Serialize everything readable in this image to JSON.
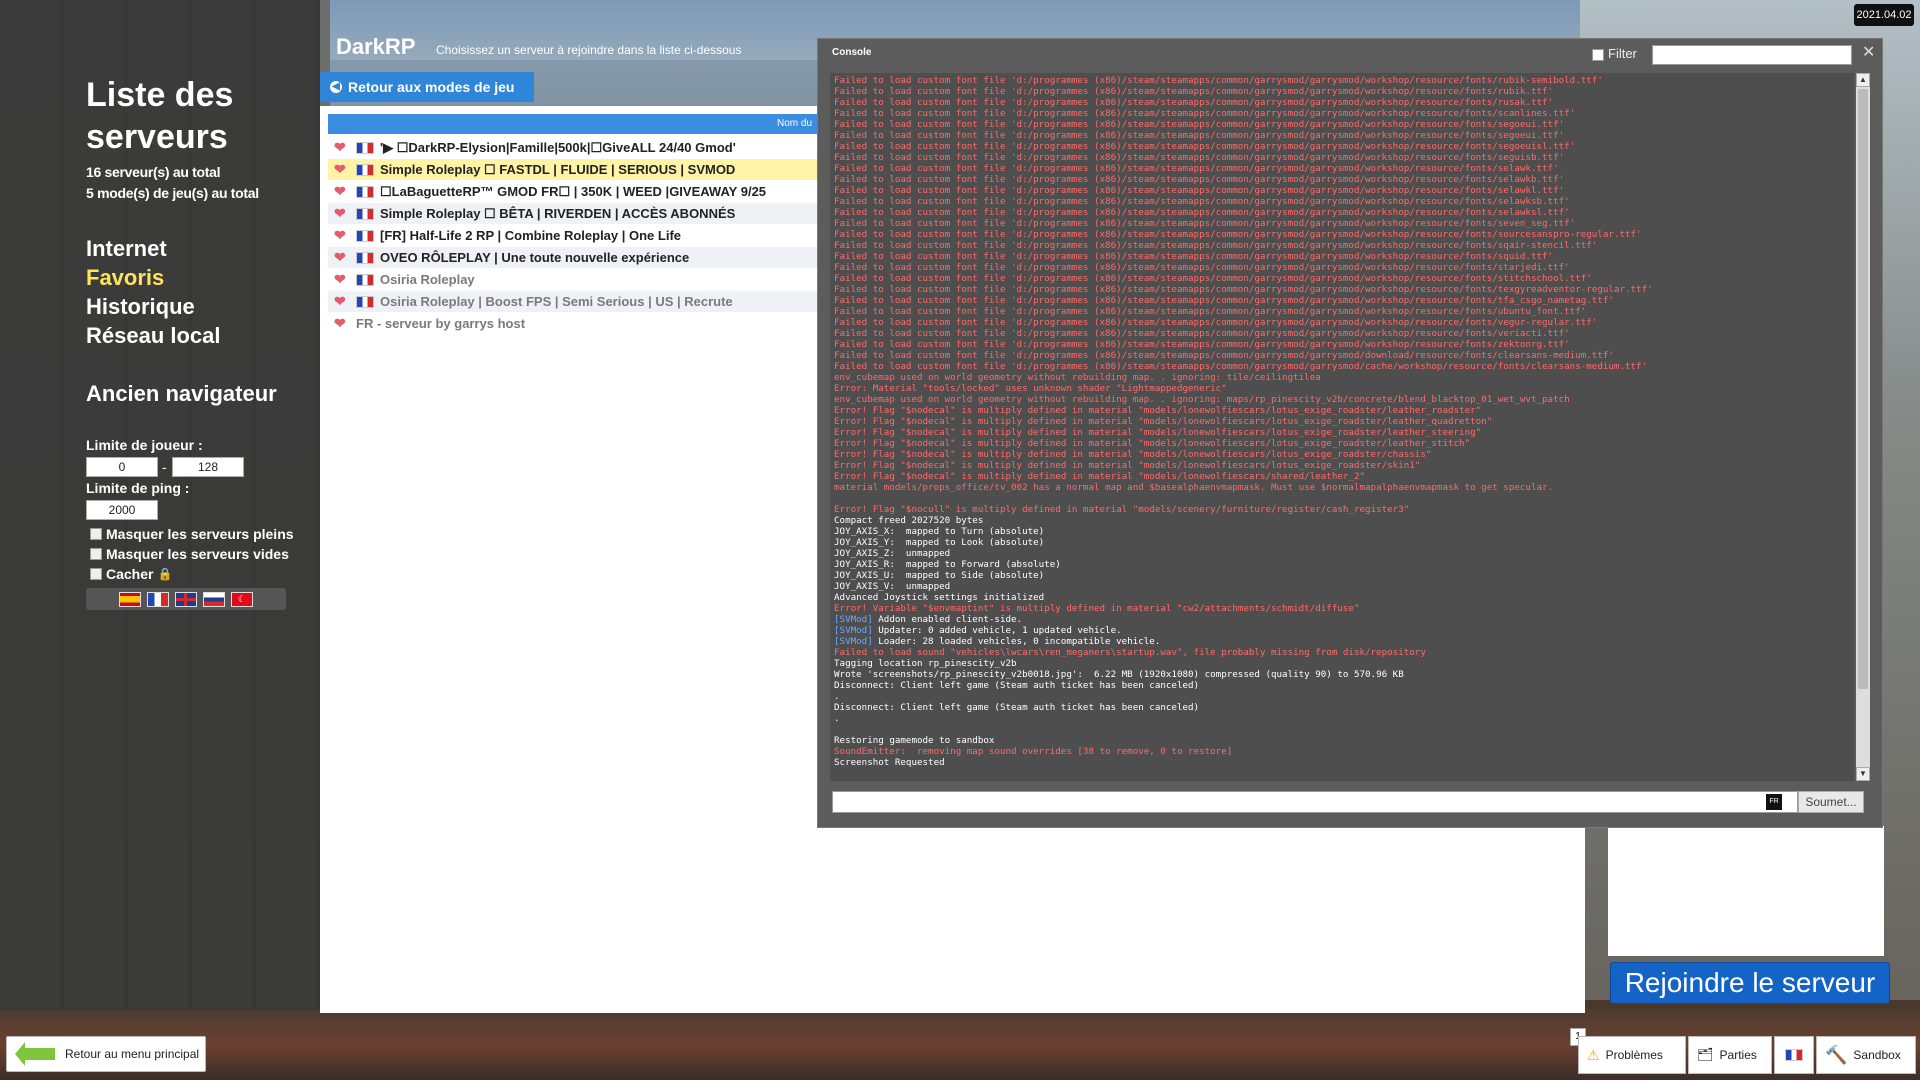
{
  "date": "2021.04.02",
  "gamemode": {
    "name": "DarkRP",
    "instruction": "Choisissez un serveur à rejoindre dans la liste ci-dessous"
  },
  "back_modes_label": "Retour aux modes de jeu",
  "sidebar": {
    "title": "Liste des serveurs",
    "total_servers": "16 serveur(s) au total",
    "total_modes": "5 mode(s) de jeu(s) au total",
    "nav": [
      "Internet",
      "Favoris",
      "Historique",
      "Réseau local"
    ],
    "legacy_browser": "Ancien navigateur",
    "player_limit_label": "Limite de joueur :",
    "player_min": "0",
    "player_max": "128",
    "ping_limit_label": "Limite de ping :",
    "ping_value": "2000",
    "hide_full": "Masquer les serveurs pleins",
    "hide_empty": "Masquer les serveurs vides",
    "hide_locked": "Cacher",
    "flags": [
      "flag-es",
      "flag-fr",
      "flag-gb",
      "flag-ru",
      "flag-tr"
    ]
  },
  "list": {
    "column_header": "Nom du",
    "servers": [
      "'▶ ☐DarkRP-Elysion|Famille|500k|☐GiveALL 24/40 Gmod'",
      "Simple Roleplay ☐ FASTDL | FLUIDE | SERIOUS | SVMOD",
      "☐LaBaguetteRP™ GMOD FR☐ | 350K | WEED |GIVEAWAY 9/25",
      "Simple Roleplay ☐ BÊTA | RIVERDEN | ACCÈS ABONNÉS",
      "[FR] Half-Life 2 RP | Combine Roleplay | One Life",
      "OVEO RÔLEPLAY | Une toute nouvelle expérience",
      "Osiria Roleplay",
      "Osiria Roleplay | Boost FPS | Semi Serious | US | Recrute",
      "FR - serveur by garrys host"
    ]
  },
  "console": {
    "title": "Console",
    "filter_label": "Filter",
    "submit_label": "Soumet...",
    "lang_badge": "FR",
    "lines": [
      {
        "t": "e",
        "s": "Failed to load custom font file 'd:/programmes (x86)/steam/steamapps/common/garrysmod/garrysmod/workshop/resource/fonts/rubik-semibold.ttf'"
      },
      {
        "t": "e",
        "s": "Failed to load custom font file 'd:/programmes (x86)/steam/steamapps/common/garrysmod/garrysmod/workshop/resource/fonts/rubik.ttf'"
      },
      {
        "t": "e",
        "s": "Failed to load custom font file 'd:/programmes (x86)/steam/steamapps/common/garrysmod/garrysmod/workshop/resource/fonts/rusak.ttf'"
      },
      {
        "t": "e",
        "s": "Failed to load custom font file 'd:/programmes (x86)/steam/steamapps/common/garrysmod/garrysmod/workshop/resource/fonts/scanlines.ttf'"
      },
      {
        "t": "e",
        "s": "Failed to load custom font file 'd:/programmes (x86)/steam/steamapps/common/garrysmod/garrysmod/workshop/resource/fonts/segoeui.ttf'"
      },
      {
        "t": "e",
        "s": "Failed to load custom font file 'd:/programmes (x86)/steam/steamapps/common/garrysmod/garrysmod/workshop/resource/fonts/segoeui.ttf'"
      },
      {
        "t": "e",
        "s": "Failed to load custom font file 'd:/programmes (x86)/steam/steamapps/common/garrysmod/garrysmod/workshop/resource/fonts/segoeuisl.ttf'"
      },
      {
        "t": "e",
        "s": "Failed to load custom font file 'd:/programmes (x86)/steam/steamapps/common/garrysmod/garrysmod/workshop/resource/fonts/seguisb.ttf'"
      },
      {
        "t": "e",
        "s": "Failed to load custom font file 'd:/programmes (x86)/steam/steamapps/common/garrysmod/garrysmod/workshop/resource/fonts/selawk.ttf'"
      },
      {
        "t": "e",
        "s": "Failed to load custom font file 'd:/programmes (x86)/steam/steamapps/common/garrysmod/garrysmod/workshop/resource/fonts/selawkb.ttf'"
      },
      {
        "t": "e",
        "s": "Failed to load custom font file 'd:/programmes (x86)/steam/steamapps/common/garrysmod/garrysmod/workshop/resource/fonts/selawkl.ttf'"
      },
      {
        "t": "e",
        "s": "Failed to load custom font file 'd:/programmes (x86)/steam/steamapps/common/garrysmod/garrysmod/workshop/resource/fonts/selawksb.ttf'"
      },
      {
        "t": "e",
        "s": "Failed to load custom font file 'd:/programmes (x86)/steam/steamapps/common/garrysmod/garrysmod/workshop/resource/fonts/selawksl.ttf'"
      },
      {
        "t": "e",
        "s": "Failed to load custom font file 'd:/programmes (x86)/steam/steamapps/common/garrysmod/garrysmod/workshop/resource/fonts/seven_seg.ttf'"
      },
      {
        "t": "e",
        "s": "Failed to load custom font file 'd:/programmes (x86)/steam/steamapps/common/garrysmod/garrysmod/workshop/resource/fonts/sourcesanspro-regular.ttf'"
      },
      {
        "t": "e",
        "s": "Failed to load custom font file 'd:/programmes (x86)/steam/steamapps/common/garrysmod/garrysmod/workshop/resource/fonts/sqair-stencil.ttf'"
      },
      {
        "t": "e",
        "s": "Failed to load custom font file 'd:/programmes (x86)/steam/steamapps/common/garrysmod/garrysmod/workshop/resource/fonts/squid.ttf'"
      },
      {
        "t": "e",
        "s": "Failed to load custom font file 'd:/programmes (x86)/steam/steamapps/common/garrysmod/garrysmod/workshop/resource/fonts/starjedi.ttf'"
      },
      {
        "t": "e",
        "s": "Failed to load custom font file 'd:/programmes (x86)/steam/steamapps/common/garrysmod/garrysmod/workshop/resource/fonts/stitchschool.ttf'"
      },
      {
        "t": "e",
        "s": "Failed to load custom font file 'd:/programmes (x86)/steam/steamapps/common/garrysmod/garrysmod/workshop/resource/fonts/texgyreadventor-regular.ttf'"
      },
      {
        "t": "e",
        "s": "Failed to load custom font file 'd:/programmes (x86)/steam/steamapps/common/garrysmod/garrysmod/workshop/resource/fonts/tfa_csgo_nametag.ttf'"
      },
      {
        "t": "e",
        "s": "Failed to load custom font file 'd:/programmes (x86)/steam/steamapps/common/garrysmod/garrysmod/workshop/resource/fonts/ubuntu_font.ttf'"
      },
      {
        "t": "e",
        "s": "Failed to load custom font file 'd:/programmes (x86)/steam/steamapps/common/garrysmod/garrysmod/workshop/resource/fonts/vegur-regular.ttf'"
      },
      {
        "t": "e",
        "s": "Failed to load custom font file 'd:/programmes (x86)/steam/steamapps/common/garrysmod/garrysmod/workshop/resource/fonts/veriacti.ttf'"
      },
      {
        "t": "e",
        "s": "Failed to load custom font file 'd:/programmes (x86)/steam/steamapps/common/garrysmod/garrysmod/workshop/resource/fonts/zektonrg.ttf'"
      },
      {
        "t": "e",
        "s": "Failed to load custom font file 'd:/programmes (x86)/steam/steamapps/common/garrysmod/garrysmod/download/resource/fonts/clearsans-medium.ttf'"
      },
      {
        "t": "e",
        "s": "Failed to load custom font file 'd:/programmes (x86)/steam/steamapps/common/garrysmod/garrysmod/cache/workshop/resource/fonts/clearsans-medium.ttf'"
      },
      {
        "t": "e",
        "s": "env_cubemap used on world geometry without rebuilding map. . ignoring: tile/ceilingtilea"
      },
      {
        "t": "e",
        "s": "Error: Material \"tools/locked\" uses unknown shader \"Lightmappedgeneric\""
      },
      {
        "t": "e",
        "s": "env_cubemap used on world geometry without rebuilding map. . ignoring: maps/rp_pinescity_v2b/concrete/blend_blacktop_01_wet_wvt_patch"
      },
      {
        "t": "e",
        "s": "Error! Flag \"$nodecal\" is multiply defined in material \"models/lonewolfiescars/lotus_exige_roadster/leather_roadster\""
      },
      {
        "t": "e",
        "s": "Error! Flag \"$nodecal\" is multiply defined in material \"models/lonewolfiescars/lotus_exige_roadster/leather_quadretton\""
      },
      {
        "t": "e",
        "s": "Error! Flag \"$nodecal\" is multiply defined in material \"models/lonewolfiescars/lotus_exige_roadster/leather_steering\""
      },
      {
        "t": "e",
        "s": "Error! Flag \"$nodecal\" is multiply defined in material \"models/lonewolfiescars/lotus_exige_roadster/leather_stitch\""
      },
      {
        "t": "e",
        "s": "Error! Flag \"$nodecal\" is multiply defined in material \"models/lonewolfiescars/lotus_exige_roadster/chassis\""
      },
      {
        "t": "e",
        "s": "Error! Flag \"$nodecal\" is multiply defined in material \"models/lonewolfiescars/lotus_exige_roadster/skin1\""
      },
      {
        "t": "e",
        "s": "Error! Flag \"$nodecal\" is multiply defined in material \"models/lonewolfiescars/shared/leather_2\""
      },
      {
        "t": "e",
        "s": "material models/props_office/tv_002 has a normal map and $basealphaenvmapmask. Must use $normalmapalphaenvmapmask to get specular."
      },
      {
        "t": "n",
        "s": " "
      },
      {
        "t": "e",
        "s": "Error! Flag \"$nocull\" is multiply defined in material \"models/scenery/furniture/register/cash_register3\""
      },
      {
        "t": "n",
        "s": "Compact freed 2027520 bytes"
      },
      {
        "t": "n",
        "s": "JOY_AXIS_X:  mapped to Turn (absolute)"
      },
      {
        "t": "n",
        "s": "JOY_AXIS_Y:  mapped to Look (absolute)"
      },
      {
        "t": "n",
        "s": "JOY_AXIS_Z:  unmapped"
      },
      {
        "t": "n",
        "s": "JOY_AXIS_R:  mapped to Forward (absolute)"
      },
      {
        "t": "n",
        "s": "JOY_AXIS_U:  mapped to Side (absolute)"
      },
      {
        "t": "n",
        "s": "JOY_AXIS_V:  unmapped"
      },
      {
        "t": "n",
        "s": "Advanced Joystick settings initialized"
      },
      {
        "t": "e",
        "s": "Error! Variable \"$envmaptint\" is multiply defined in material \"cw2/attachments/schmidt/diffuse\""
      },
      {
        "t": "svm",
        "tag": "[SVMod]",
        "s": " Addon enabled client-side."
      },
      {
        "t": "svm",
        "tag": "[SVMod]",
        "s": " Updater: 0 added vehicle, 1 updated vehicle."
      },
      {
        "t": "svm",
        "tag": "[SVMod]",
        "s": " Loader: 28 loaded vehicles, 0 incompatible vehicle."
      },
      {
        "t": "e",
        "s": "Failed to load sound \"vehicles\\lwcars\\ren_meganers\\startup.wav\", file probably missing from disk/repository"
      },
      {
        "t": "n",
        "s": "Tagging location rp_pinescity_v2b"
      },
      {
        "t": "n",
        "s": "Wrote 'screenshots/rp_pinescity_v2b0018.jpg':  6.22 MB (1920x1080) compressed (quality 90) to 570.96 KB"
      },
      {
        "t": "n",
        "s": "Disconnect: Client left game (Steam auth ticket has been canceled)"
      },
      {
        "t": "n",
        "s": "."
      },
      {
        "t": "n",
        "s": "Disconnect: Client left game (Steam auth ticket has been canceled)"
      },
      {
        "t": "n",
        "s": "."
      },
      {
        "t": "n",
        "s": " "
      },
      {
        "t": "n",
        "s": "Restoring gamemode to sandbox"
      },
      {
        "t": "e",
        "s": "SoundEmitter:  removing map sound overrides [38 to remove, 0 to restore]"
      },
      {
        "t": "n",
        "s": "Screenshot Requested"
      }
    ]
  },
  "join_label": "Rejoindre le serveur",
  "footer": {
    "back_menu": "Retour au menu principal",
    "problems": "Problèmes",
    "problems_count": "1",
    "games": "Parties",
    "sandbox": "Sandbox"
  }
}
